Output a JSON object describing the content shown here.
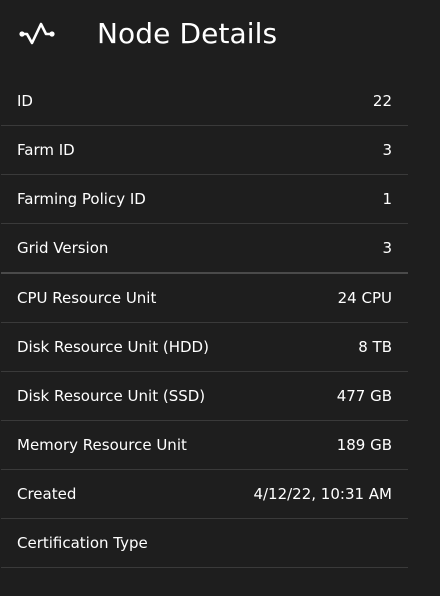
{
  "header": {
    "icon": "activity-pulse-icon",
    "title": "Node Details"
  },
  "details": [
    {
      "label": "ID",
      "value": "22"
    },
    {
      "label": "Farm ID",
      "value": "3"
    },
    {
      "label": "Farming Policy ID",
      "value": "1"
    },
    {
      "label": "Grid Version",
      "value": "3"
    },
    {
      "label": "CPU Resource Unit",
      "value": "24 CPU"
    },
    {
      "label": "Disk Resource Unit (HDD)",
      "value": "8 TB"
    },
    {
      "label": "Disk Resource Unit (SSD)",
      "value": "477 GB"
    },
    {
      "label": "Memory Resource Unit",
      "value": "189 GB"
    },
    {
      "label": "Created",
      "value": "4/12/22, 10:31 AM"
    },
    {
      "label": "Certification Type",
      "value": ""
    }
  ]
}
